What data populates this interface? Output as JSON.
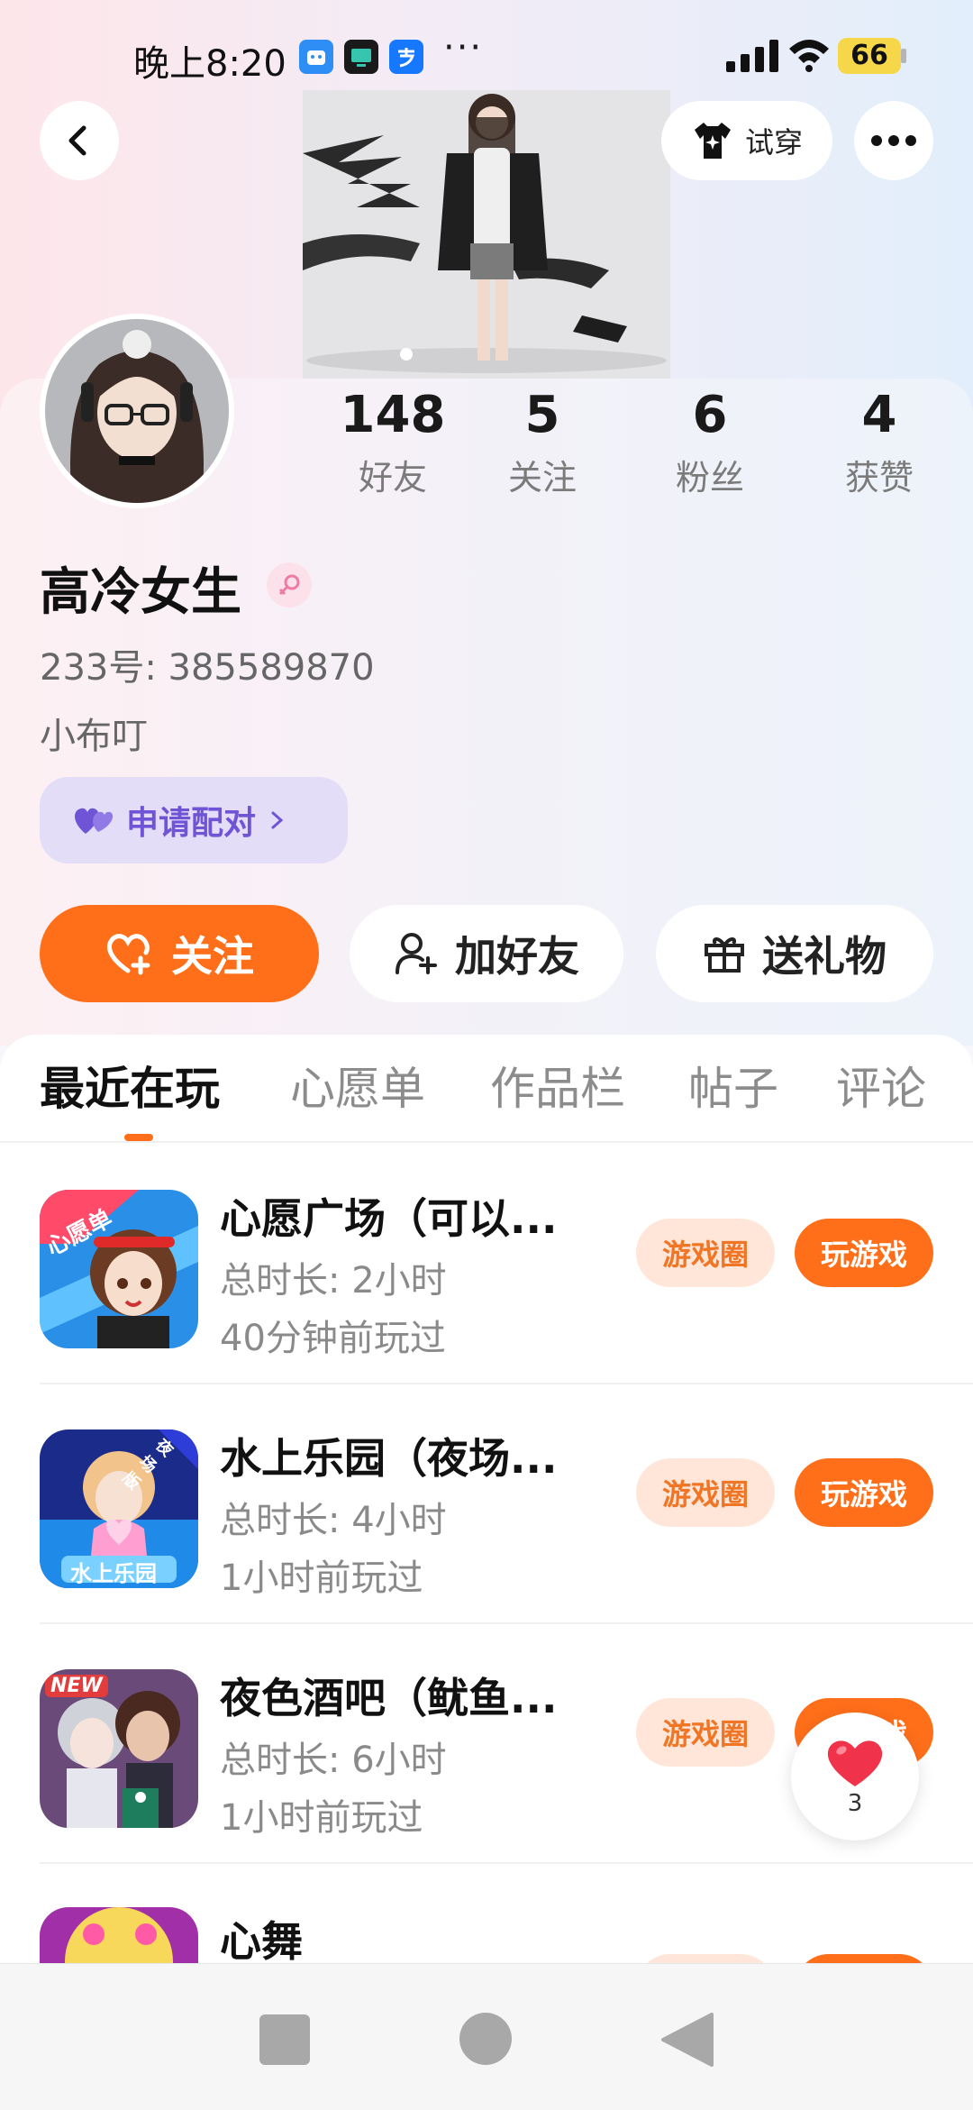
{
  "status_bar": {
    "time": "晚上8:20",
    "more": "···",
    "battery": "66"
  },
  "header": {
    "try_on_label": "试穿"
  },
  "profile": {
    "username": "高冷女生",
    "uid": "233号: 385589870",
    "signature": "小布叮",
    "pair_label": "申请配对"
  },
  "stats": [
    {
      "num": "148",
      "label": "好友"
    },
    {
      "num": "5",
      "label": "关注"
    },
    {
      "num": "6",
      "label": "粉丝"
    },
    {
      "num": "4",
      "label": "获赞"
    }
  ],
  "actions": {
    "follow": "关注",
    "add_friend": "加好友",
    "send_gift": "送礼物"
  },
  "tabs": [
    "最近在玩",
    "心愿单",
    "作品栏",
    "帖子",
    "评论"
  ],
  "games": [
    {
      "title": "心愿广场（可以...",
      "duration": "总时长: 2小时",
      "last_played": "40分钟前玩过",
      "icon_text": "心愿单"
    },
    {
      "title": "水上乐园（夜场...",
      "duration": "总时长: 4小时",
      "last_played": "1小时前玩过",
      "icon_text": "水上乐园",
      "icon_badge": "夜场版"
    },
    {
      "title": "夜色酒吧（鱿鱼...",
      "duration": "总时长: 6小时",
      "last_played": "1小时前玩过",
      "icon_badge": "NEW"
    },
    {
      "title": "心舞",
      "duration": "",
      "last_played": ""
    }
  ],
  "game_buttons": {
    "circle": "游戏圈",
    "play": "玩游戏"
  },
  "float_like": {
    "count": "3"
  },
  "colors": {
    "accent": "#ff6f1a",
    "pair_purple": "#6f55d6",
    "circle_bg": "#ffe6d8"
  }
}
